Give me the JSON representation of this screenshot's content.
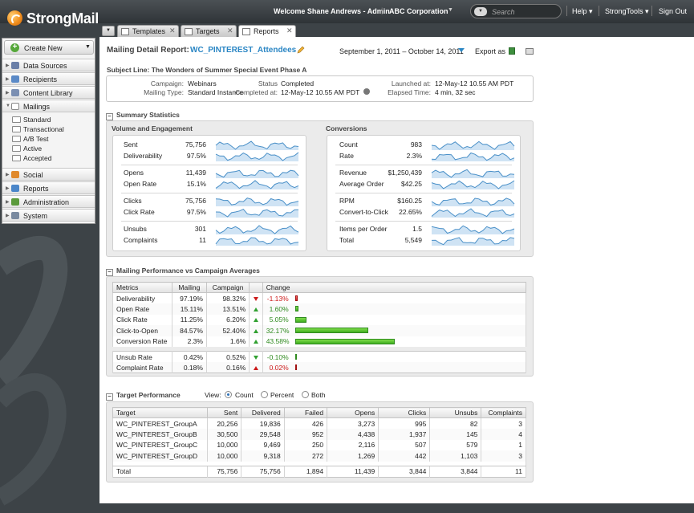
{
  "app": {
    "name": "StrongMail"
  },
  "topbar": {
    "welcome": "Welcome Shane Andrews - Admin",
    "company": "ABC Corporation",
    "search_placeholder": "Search",
    "help": "Help ▾",
    "strongtools": "StrongTools ▾",
    "signout": "Sign Out"
  },
  "sidebar": {
    "create_new": "Create New",
    "sections": [
      {
        "label": "Data Sources",
        "icon": "database-icon",
        "color": "#6a7fa8"
      },
      {
        "label": "Recipients",
        "icon": "people-icon",
        "color": "#5b8ac7"
      },
      {
        "label": "Content Library",
        "icon": "library-icon",
        "color": "#7b8fb2"
      },
      {
        "label": "Mailings",
        "icon": "envelope-icon",
        "color": "#ffffff"
      },
      {
        "label": "Social",
        "icon": "social-icon",
        "color": "#e08a2d"
      },
      {
        "label": "Reports",
        "icon": "chart-icon",
        "color": "#4b86c9"
      },
      {
        "label": "Administration",
        "icon": "admin-icon",
        "color": "#5b9a3c"
      },
      {
        "label": "System",
        "icon": "system-icon",
        "color": "#7a8aa0"
      }
    ],
    "mailings_items": [
      "Standard",
      "Transactional",
      "A/B Test",
      "Active",
      "Accepted"
    ]
  },
  "tabs": [
    {
      "label": "Templates",
      "icon": "templates-icon"
    },
    {
      "label": "Targets",
      "icon": "targets-icon"
    },
    {
      "label": "Reports",
      "icon": "reports-chart-icon"
    }
  ],
  "report": {
    "title_label": "Mailing Detail Report:",
    "title_name": "WC_PINTEREST_Attendees",
    "date_range": "September 1, 2011 – October 14, 2011",
    "export_as": "Export as",
    "subject_line": "Subject Line:  The Wonders of Summer Special Event Phase A",
    "info": {
      "campaign_label": "Campaign:",
      "campaign": "Webinars",
      "mailing_type_label": "Mailing Type:",
      "mailing_type": "Standard Instance",
      "status_label": "Status",
      "status": "Completed",
      "completed_label": "Completed at:",
      "completed": "12-May-12 10.55 AM PDT",
      "launched_label": "Launched at:",
      "launched": "12-May-12 10.55 AM PDT",
      "elapsed_label": "Elapsed Time:",
      "elapsed": "4 min, 32 sec"
    }
  },
  "summary": {
    "heading": "Summary Statistics",
    "volume_title": "Volume and Engagement",
    "conversions_title": "Conversions",
    "volume": [
      {
        "label": "Sent",
        "value": "75,756"
      },
      {
        "label": "Deliverability",
        "value": "97.5%"
      },
      {
        "label": "Opens",
        "value": "11,439"
      },
      {
        "label": "Open Rate",
        "value": "15.1%"
      },
      {
        "label": "Clicks",
        "value": "75,756"
      },
      {
        "label": "Click Rate",
        "value": "97.5%"
      },
      {
        "label": "Unsubs",
        "value": "301"
      },
      {
        "label": "Complaints",
        "value": "11"
      }
    ],
    "conversions": [
      {
        "label": "Count",
        "value": "983"
      },
      {
        "label": "Rate",
        "value": "2.3%"
      },
      {
        "label": "Revenue",
        "value": "$1,250,439"
      },
      {
        "label": "Average Order",
        "value": "$42.25"
      },
      {
        "label": "RPM",
        "value": "$160.25"
      },
      {
        "label": "Convert-to-Click",
        "value": "22.65%"
      },
      {
        "label": "Items per Order",
        "value": "1.5"
      },
      {
        "label": "Total",
        "value": "5,549"
      }
    ]
  },
  "performance": {
    "heading": "Mailing Performance vs Campaign Averages",
    "headers": [
      "Metrics",
      "Mailing",
      "Campaign",
      "",
      "Change"
    ],
    "rows": [
      {
        "metric": "Deliverability",
        "mailing": "97.19%",
        "campaign": "98.32%",
        "dir": "down",
        "change": "-1.13%",
        "change_value": -1.13,
        "good": false
      },
      {
        "metric": "Open Rate",
        "mailing": "15.11%",
        "campaign": "13.51%",
        "dir": "up",
        "change": "1.60%",
        "change_value": 1.6,
        "good": true
      },
      {
        "metric": "Click Rate",
        "mailing": "11.25%",
        "campaign": "6.20%",
        "dir": "up",
        "change": "5.05%",
        "change_value": 5.05,
        "good": true
      },
      {
        "metric": "Click-to-Open",
        "mailing": "84.57%",
        "campaign": "52.40%",
        "dir": "up",
        "change": "32.17%",
        "change_value": 32.17,
        "good": true
      },
      {
        "metric": "Conversion Rate",
        "mailing": "2.3%",
        "campaign": "1.6%",
        "dir": "up",
        "change": "43.58%",
        "change_value": 43.58,
        "good": true
      }
    ],
    "rows2": [
      {
        "metric": "Unsub Rate",
        "mailing": "0.42%",
        "campaign": "0.52%",
        "dir": "down",
        "change": "-0.10%",
        "change_value": -0.1,
        "good": true
      },
      {
        "metric": "Complaint Rate",
        "mailing": "0.18%",
        "campaign": "0.16%",
        "dir": "up",
        "change": "0.02%",
        "change_value": 0.02,
        "good": false
      }
    ]
  },
  "targets": {
    "heading": "Target Performance",
    "view_label": "View:",
    "view_options": [
      "Count",
      "Percent",
      "Both"
    ],
    "view_selected": 0,
    "headers": [
      "Target",
      "Sent",
      "Delivered",
      "Failed",
      "Opens",
      "Clicks",
      "Unsubs",
      "Complaints"
    ],
    "rows": [
      [
        "WC_PINTEREST_GroupA",
        "20,256",
        "19,836",
        "426",
        "3,273",
        "995",
        "82",
        "3"
      ],
      [
        "WC_PINTEREST_GroupB",
        "30,500",
        "29,548",
        "952",
        "4,438",
        "1,937",
        "145",
        "4"
      ],
      [
        "WC_PINTEREST_GroupC",
        "10,000",
        "9,469",
        "250",
        "2,116",
        "507",
        "579",
        "1"
      ],
      [
        "WC_PINTEREST_GroupD",
        "10,000",
        "9,318",
        "272",
        "1,269",
        "442",
        "1,103",
        "3"
      ]
    ],
    "total": [
      "Total",
      "75,756",
      "75,756",
      "1,894",
      "11,439",
      "3,844",
      "3,844",
      "11"
    ]
  },
  "colors": {
    "accent": "#2b86c4",
    "sparkline": "#4a90c8",
    "positive": "#2f8a1f",
    "negative": "#cc1a1a"
  }
}
